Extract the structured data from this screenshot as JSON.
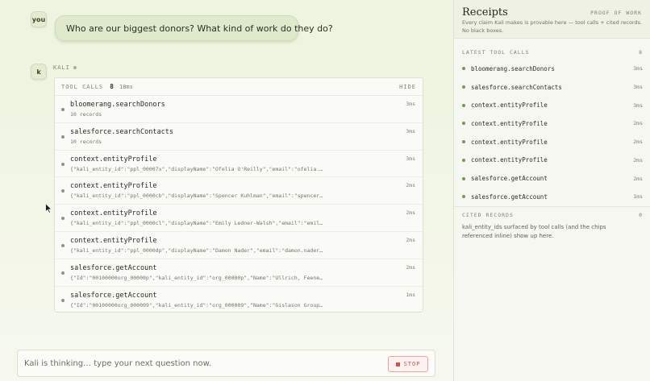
{
  "chat": {
    "user_avatar": "you",
    "user_message": "Who are our biggest donors? What kind of work do they do?",
    "kali_avatar": "k",
    "kali_label": "KALI",
    "tool_panel": {
      "label": "TOOL CALLS",
      "count": "8",
      "duration": "18ms",
      "hide_label": "HIDE",
      "calls": [
        {
          "name": "bloomerang.searchDonors",
          "detail": "10 records",
          "ms": "3ms"
        },
        {
          "name": "salesforce.searchContacts",
          "detail": "10 records",
          "ms": "3ms"
        },
        {
          "name": "context.entityProfile",
          "detail": "{\"kali_entity_id\":\"ppl_00007x\",\"displayName\":\"Ofelia O'Reilly\",\"email\":\"ofelia.…",
          "ms": "3ms"
        },
        {
          "name": "context.entityProfile",
          "detail": "{\"kali_entity_id\":\"ppl_0000cb\",\"displayName\":\"Spencer Kuhlman\",\"email\":\"spencer…",
          "ms": "2ms"
        },
        {
          "name": "context.entityProfile",
          "detail": "{\"kali_entity_id\":\"ppl_0000cl\",\"displayName\":\"Emily Ledner-Walsh\",\"email\":\"emil…",
          "ms": "2ms"
        },
        {
          "name": "context.entityProfile",
          "detail": "{\"kali_entity_id\":\"ppl_0000dp\",\"displayName\":\"Damon Nader\",\"email\":\"damon.nader…",
          "ms": "2ms"
        },
        {
          "name": "salesforce.getAccount",
          "detail": "{\"Id\":\"00100000org_00000p\",\"kali_entity_id\":\"org_00000p\",\"Name\":\"Ullrich, Feene…",
          "ms": "2ms"
        },
        {
          "name": "salesforce.getAccount",
          "detail": "{\"Id\":\"00100000org_000009\",\"kali_entity_id\":\"org_000009\",\"Name\":\"Gislason Group…",
          "ms": "1ms"
        }
      ]
    },
    "composer": {
      "placeholder": "Kali is thinking… type your next question now.",
      "stop_label": "STOP"
    }
  },
  "receipts": {
    "title": "Receipts",
    "proof_label": "PROOF OF WORK",
    "description": "Every claim Kali makes is provable here — tool calls + cited records. No black boxes.",
    "latest": {
      "label": "LATEST TOOL CALLS",
      "count": "8",
      "items": [
        {
          "name": "bloomerang.searchDonors",
          "ms": "3ms"
        },
        {
          "name": "salesforce.searchContacts",
          "ms": "3ms"
        },
        {
          "name": "context.entityProfile",
          "ms": "3ms"
        },
        {
          "name": "context.entityProfile",
          "ms": "2ms"
        },
        {
          "name": "context.entityProfile",
          "ms": "2ms"
        },
        {
          "name": "context.entityProfile",
          "ms": "2ms"
        },
        {
          "name": "salesforce.getAccount",
          "ms": "2ms"
        },
        {
          "name": "salesforce.getAccount",
          "ms": "1ms"
        }
      ]
    },
    "cited": {
      "label": "CITED RECORDS",
      "count": "0",
      "description": "kali_entity_ids surfaced by tool calls (and the chips referenced inline) show up here."
    }
  },
  "colors": {
    "accent_green": "#6f9a55",
    "stop_red": "#c9544d",
    "bubble_green": "#dfeacd"
  },
  "icons": {
    "status": "status-dot-icon",
    "stop": "stop-square-icon",
    "cursor": "mouse-pointer-icon"
  }
}
